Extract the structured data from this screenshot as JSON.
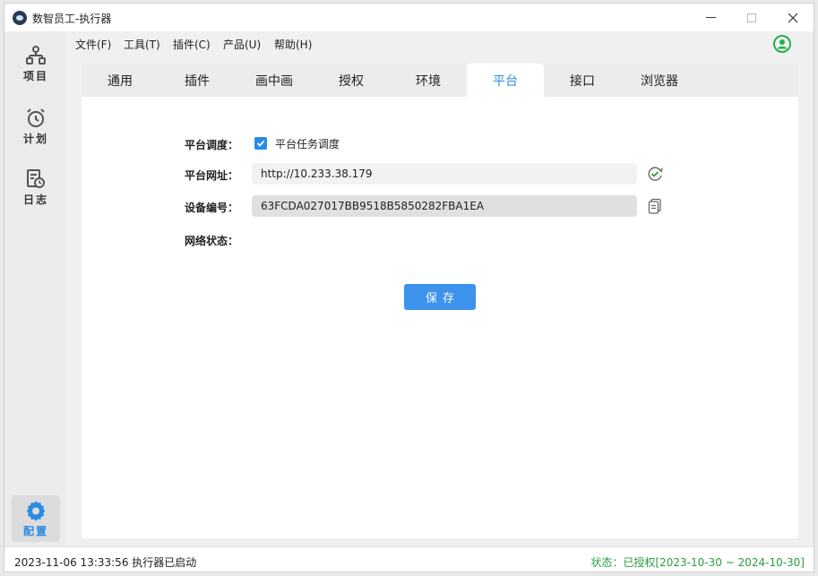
{
  "window": {
    "title": "数智员工-执行器"
  },
  "sidebar": {
    "items": [
      {
        "label": "项目",
        "icon": "project-tree-icon"
      },
      {
        "label": "计划",
        "icon": "alarm-clock-icon"
      },
      {
        "label": "日志",
        "icon": "log-history-icon"
      },
      {
        "label": "配置",
        "icon": "gear-icon",
        "active": true
      }
    ]
  },
  "menubar": {
    "items": [
      {
        "label": "文件(F)"
      },
      {
        "label": "工具(T)"
      },
      {
        "label": "插件(C)"
      },
      {
        "label": "产品(U)"
      },
      {
        "label": "帮助(H)"
      }
    ],
    "user_icon": "user-avatar-icon"
  },
  "tabs": [
    {
      "label": "通用"
    },
    {
      "label": "插件"
    },
    {
      "label": "画中画"
    },
    {
      "label": "授权"
    },
    {
      "label": "环境"
    },
    {
      "label": "平台",
      "active": true
    },
    {
      "label": "接口"
    },
    {
      "label": "浏览器"
    }
  ],
  "form": {
    "schedule_label": "平台调度：",
    "schedule_checkbox_label": "平台任务调度",
    "schedule_checked": true,
    "url_label": "平台网址：",
    "url_value": "http://10.233.38.179",
    "device_label": "设备编号：",
    "device_value": "63FCDA027017BB9518B5850282FBA1EA",
    "network_label": "网络状态：",
    "save_label": "保存"
  },
  "statusbar": {
    "left": "2023-11-06 13:33:56 执行器已启动",
    "right": "状态：已授权[2023-10-30 ~ 2024-10-30]"
  },
  "colors": {
    "accent": "#2b8ae6",
    "status_ok": "#2a9d3e",
    "user_icon": "#22b14c"
  }
}
